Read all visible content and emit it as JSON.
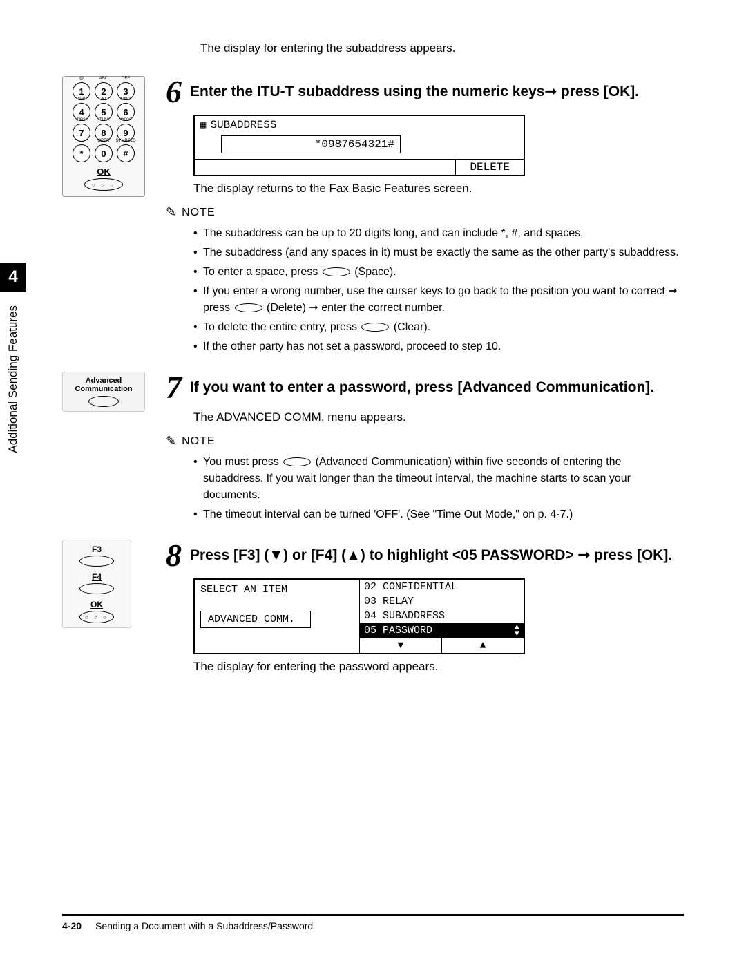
{
  "intro": "The display for entering the subaddress appears.",
  "side": {
    "chapter": "4",
    "label": "Additional Sending Features"
  },
  "keypad": {
    "rows": [
      [
        {
          "n": "1",
          "l": "@"
        },
        {
          "n": "2",
          "l": "ABC"
        },
        {
          "n": "3",
          "l": "DEF"
        }
      ],
      [
        {
          "n": "4",
          "l": "GHI"
        },
        {
          "n": "5",
          "l": "JKL"
        },
        {
          "n": "6",
          "l": "MNO"
        }
      ],
      [
        {
          "n": "7",
          "l": "PRS"
        },
        {
          "n": "8",
          "l": "TUV"
        },
        {
          "n": "9",
          "l": "WXY"
        }
      ],
      [
        {
          "n": "*",
          "l": ""
        },
        {
          "n": "0",
          "l": "OPER"
        },
        {
          "n": "#",
          "l": "SYMBOLS"
        }
      ]
    ],
    "ok": "OK",
    "dots": "○ ○ ○"
  },
  "step6": {
    "num": "6",
    "title_a": "Enter the ITU-T subaddress using the numeric keys",
    "title_b": " press [OK].",
    "lcd_label": "SUBADDRESS",
    "lcd_value": "*0987654321#",
    "lcd_delete": "DELETE",
    "after": "The display returns to the Fax Basic Features screen.",
    "note_label": "NOTE",
    "bullets": [
      "The subaddress can be up to 20 digits long, and can include *, #, and spaces.",
      "The subaddress (and any spaces in it) must be exactly the same as the other party's subaddress.",
      "To enter a space, press ",
      " (Space).",
      "If you enter a wrong number, use the curser keys to go back to the position you want to correct ➞ press ",
      " (Delete) ➞ enter the correct number.",
      "To delete the entire entry, press ",
      " (Clear).",
      "If the other party has not set a password, proceed to step 10."
    ]
  },
  "step7": {
    "num": "7",
    "btn_l1": "Advanced",
    "btn_l2": "Communication",
    "title": "If you want to enter a password, press [Advanced Communication].",
    "after": "The ADVANCED COMM. menu appears.",
    "note_label": "NOTE",
    "bullets": [
      "You must press ",
      " (Advanced Communication) within five seconds of entering the subaddress. If you wait longer than the timeout interval, the machine starts to scan your documents.",
      "The timeout interval can be turned 'OFF'. (See \"Time Out Mode,\" on p. 4-7.)"
    ]
  },
  "step8": {
    "num": "8",
    "f3": "F3",
    "f4": "F4",
    "ok": "OK",
    "title_a": "Press [F3] (▼) or [F4] (▲) to highlight <05 PASSWORD> ➞ press [OK].",
    "lcd_left_top": "SELECT AN ITEM",
    "lcd_left_sub": "ADVANCED COMM.",
    "menu": [
      "02 CONFIDENTIAL",
      "03 RELAY",
      "04 SUBADDRESS",
      "05 PASSWORD"
    ],
    "after": "The display for entering the password appears."
  },
  "footer": {
    "page": "4-20",
    "title": "Sending a Document with a Subaddress/Password"
  }
}
